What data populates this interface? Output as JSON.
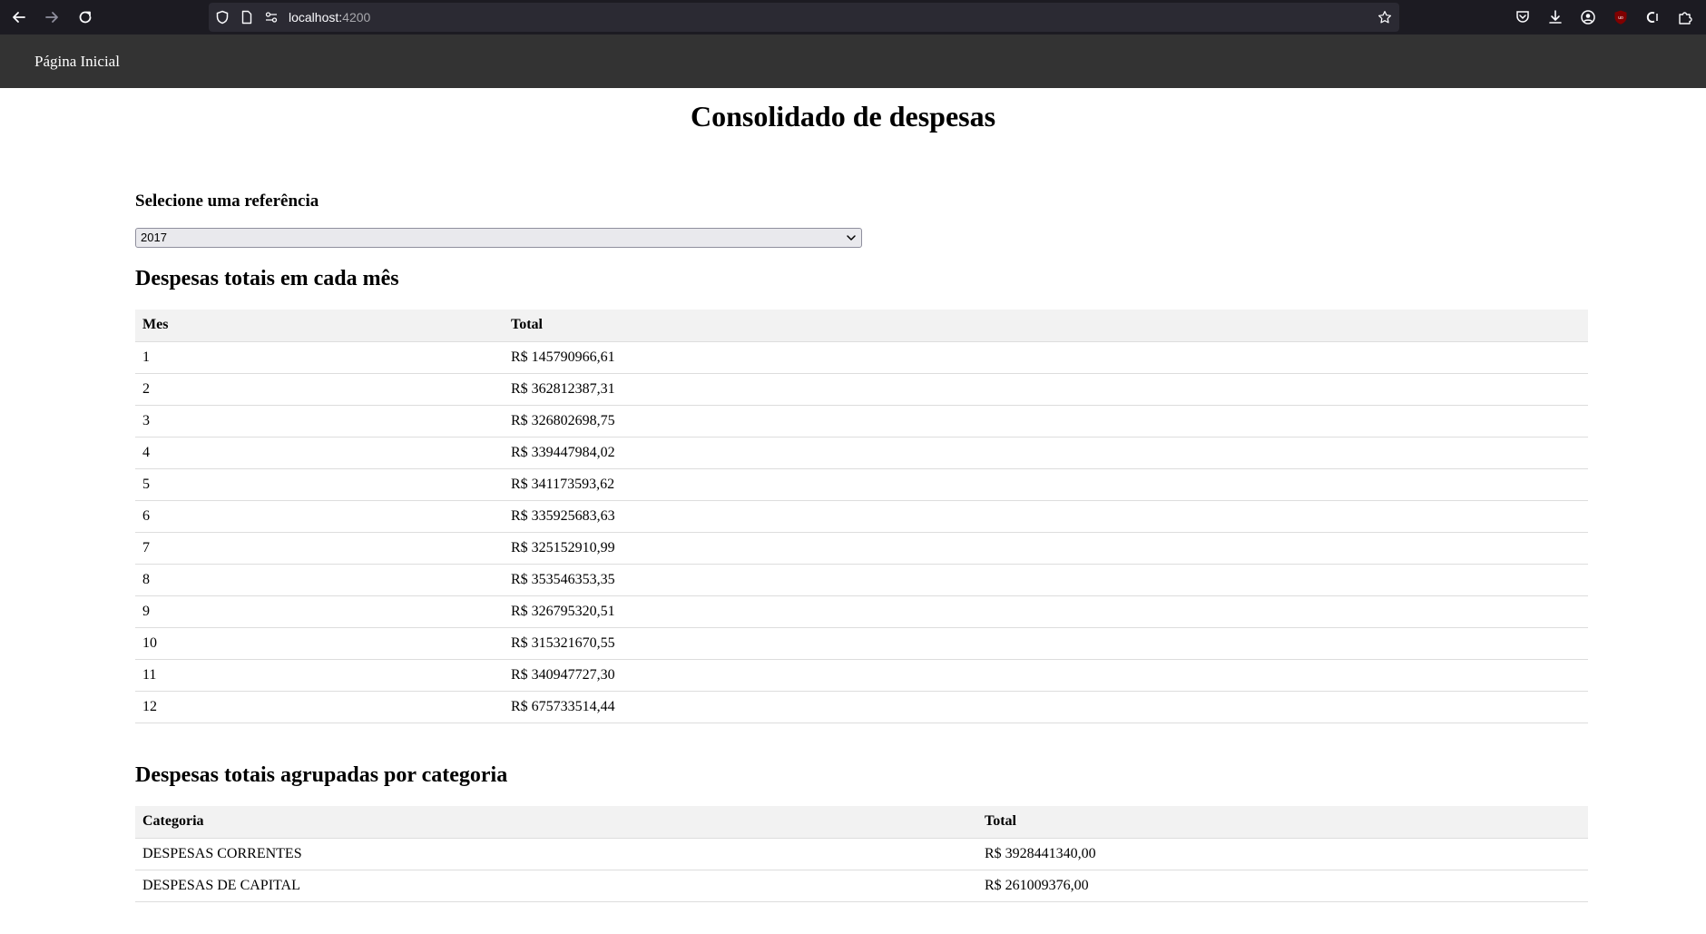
{
  "browser": {
    "url_host": "localhost:",
    "url_port": "4200"
  },
  "nav": {
    "home_link": "Página Inicial"
  },
  "page": {
    "title": "Consolidado de despesas",
    "select_label": "Selecione uma referência",
    "selected_reference": "2017"
  },
  "monthly": {
    "title": "Despesas totais em cada mês",
    "headers": [
      "Mes",
      "Total"
    ],
    "rows": [
      [
        "1",
        "R$ 145790966,61"
      ],
      [
        "2",
        "R$ 362812387,31"
      ],
      [
        "3",
        "R$ 326802698,75"
      ],
      [
        "4",
        "R$ 339447984,02"
      ],
      [
        "5",
        "R$ 341173593,62"
      ],
      [
        "6",
        "R$ 335925683,63"
      ],
      [
        "7",
        "R$ 325152910,99"
      ],
      [
        "8",
        "R$ 353546353,35"
      ],
      [
        "9",
        "R$ 326795320,51"
      ],
      [
        "10",
        "R$ 315321670,55"
      ],
      [
        "11",
        "R$ 340947727,30"
      ],
      [
        "12",
        "R$ 675733514,44"
      ]
    ]
  },
  "category": {
    "title": "Despesas totais agrupadas por categoria",
    "headers": [
      "Categoria",
      "Total"
    ],
    "rows": [
      [
        "DESPESAS CORRENTES",
        "R$ 3928441340,00"
      ],
      [
        "DESPESAS DE CAPITAL",
        "R$ 261009376,00"
      ]
    ]
  }
}
